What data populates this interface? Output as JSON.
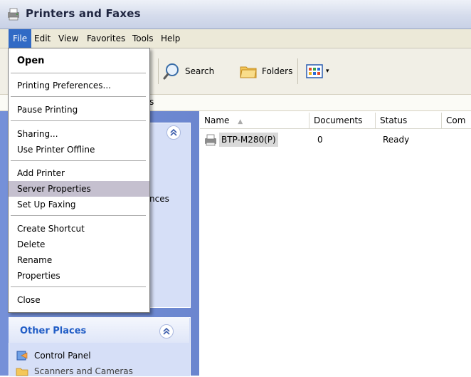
{
  "window": {
    "title": "Printers and Faxes"
  },
  "menubar": [
    "File",
    "Edit",
    "View",
    "Favorites",
    "Tools",
    "Help"
  ],
  "toolbar": {
    "search": "Search",
    "folders": "Folders"
  },
  "address": {
    "fragment": "s"
  },
  "file_menu": {
    "open": "Open",
    "printing_preferences": "Printing Preferences...",
    "pause_printing": "Pause Printing",
    "sharing": "Sharing...",
    "use_offline": "Use Printer Offline",
    "add_printer": "Add Printer",
    "server_properties": "Server Properties",
    "set_up_faxing": "Set Up Faxing",
    "create_shortcut": "Create Shortcut",
    "delete": "Delete",
    "rename": "Rename",
    "properties": "Properties",
    "close": "Close"
  },
  "task_pane": {
    "hidden_fragment": "nces",
    "other_places_title": "Other Places",
    "control_panel": "Control Panel",
    "partial_link": "Scanners and Cameras"
  },
  "list": {
    "columns": [
      "Name",
      "Documents",
      "Status",
      "Com"
    ],
    "rows": [
      {
        "name": "BTP-M280(P)",
        "documents": "0",
        "status": "Ready"
      }
    ]
  },
  "colors": {
    "accent": "#316ac5",
    "taskpane": "#6b86cf",
    "highlight": "#c5c0cf"
  }
}
